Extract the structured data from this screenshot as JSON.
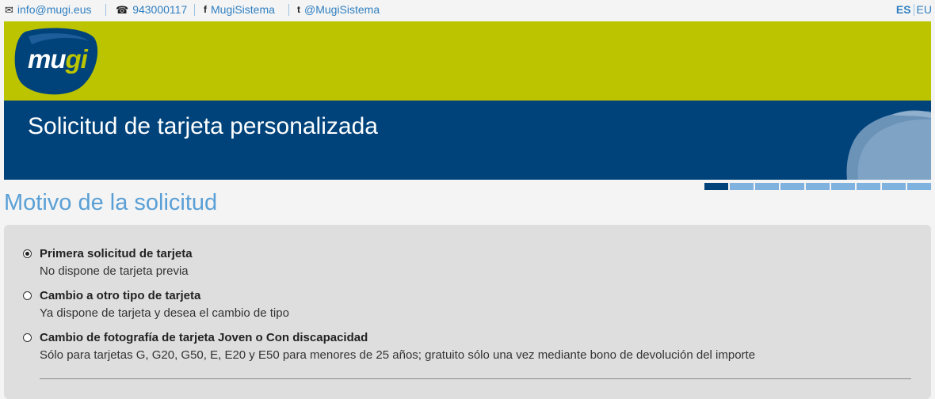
{
  "topbar": {
    "email": "info@mugi.eus",
    "phone": "943000117",
    "facebook": "MugiSistema",
    "twitter": "@MugiSistema",
    "lang_es": "ES",
    "lang_eu": "EU",
    "icons": [
      "envelope-icon",
      "phone-icon",
      "facebook-icon",
      "twitter-icon"
    ]
  },
  "header": {
    "logo_part1": "mu",
    "logo_part2": "gi",
    "title": "Solicitud de tarjeta personalizada"
  },
  "progress": {
    "total_steps": 9,
    "current_step": 1
  },
  "section": {
    "title": "Motivo de la solicitud",
    "options": [
      {
        "title": "Primera solicitud de tarjeta",
        "description": "No dispone de tarjeta previa",
        "selected": true
      },
      {
        "title": "Cambio a otro tipo de tarjeta",
        "description": "Ya dispone de tarjeta y desea el cambio de tipo",
        "selected": false
      },
      {
        "title": "Cambio de fotografía de tarjeta Joven o Con discapacidad",
        "description": "Sólo para tarjetas G, G20, G50, E, E20 y E50 para menores de 25 años; gratuito sólo una vez mediante bono de devolución del importe",
        "selected": false
      }
    ]
  },
  "colors": {
    "lime": "#bcc400",
    "navy": "#00437b",
    "link": "#2f7fc1",
    "heading": "#5aa0d6",
    "panel": "#dedede"
  }
}
